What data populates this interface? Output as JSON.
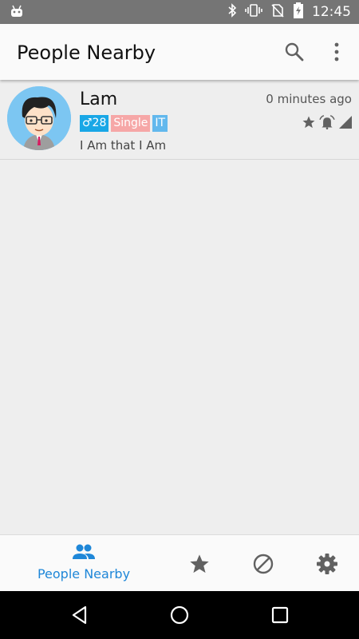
{
  "status_bar": {
    "time": "12:45",
    "icons": [
      "android-icon",
      "bluetooth-icon",
      "vibrate-icon",
      "no-sim-icon",
      "battery-charging-icon"
    ]
  },
  "app_bar": {
    "title": "People Nearby",
    "actions": [
      "search-icon",
      "more-vert-icon"
    ]
  },
  "people": [
    {
      "name": "Lam",
      "gender_age": "♂28",
      "relationship": "Single",
      "occupation": "IT",
      "bio": "I Am that I Am",
      "last_seen": "0 minutes ago",
      "status_icons": [
        "star-icon",
        "alarm-icon",
        "signal-icon"
      ]
    }
  ],
  "bottom_nav": {
    "items": [
      {
        "label": "People Nearby",
        "icon": "people-icon",
        "active": true
      },
      {
        "label": "",
        "icon": "star-icon",
        "active": false
      },
      {
        "label": "",
        "icon": "block-icon",
        "active": false
      },
      {
        "label": "",
        "icon": "settings-icon",
        "active": false
      }
    ]
  },
  "colors": {
    "accent": "#1f87d8",
    "status_bar": "#757575",
    "tag_gender": "#19a7e6",
    "tag_status": "#f6a7a7",
    "tag_job": "#62b8ed"
  }
}
